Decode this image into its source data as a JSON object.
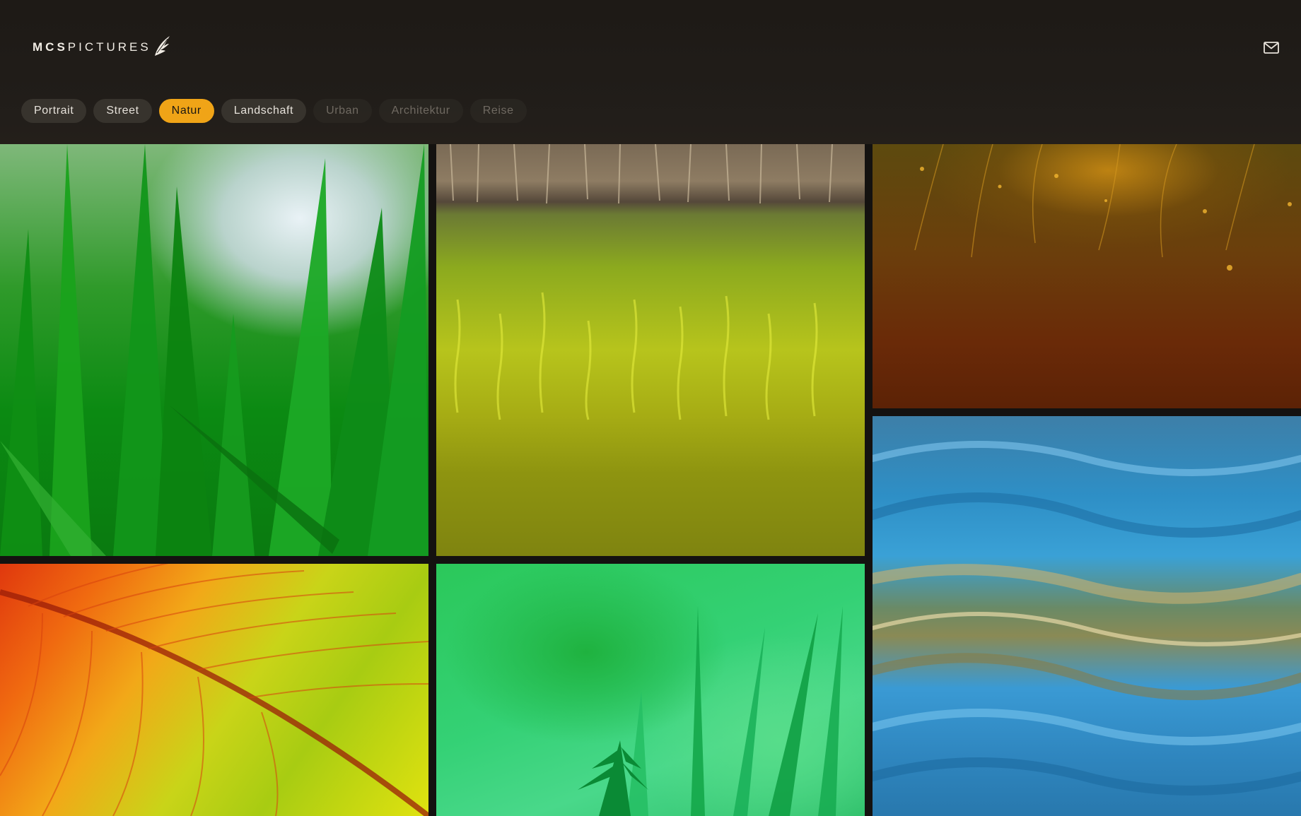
{
  "brand": {
    "name_bold": "MCS",
    "name_light": "PICTURES",
    "logo_icon": "wing-icon"
  },
  "header": {
    "mail_icon": "mail-icon",
    "accent_color": "#f0a417"
  },
  "filters": {
    "items": [
      {
        "label": "Portrait",
        "state": "normal"
      },
      {
        "label": "Street",
        "state": "normal"
      },
      {
        "label": "Natur",
        "state": "active"
      },
      {
        "label": "Landschaft",
        "state": "normal"
      },
      {
        "label": "Urban",
        "state": "dim"
      },
      {
        "label": "Architektur",
        "state": "dim"
      },
      {
        "label": "Reise",
        "state": "dim"
      }
    ]
  },
  "gallery": {
    "photos": [
      {
        "subject": "grass close-up"
      },
      {
        "subject": "reeds reflected in water"
      },
      {
        "subject": "backlit golden grass"
      },
      {
        "subject": "blue water ripples"
      },
      {
        "subject": "leaf veins orange and yellow"
      },
      {
        "subject": "fern on green bokeh"
      }
    ]
  }
}
